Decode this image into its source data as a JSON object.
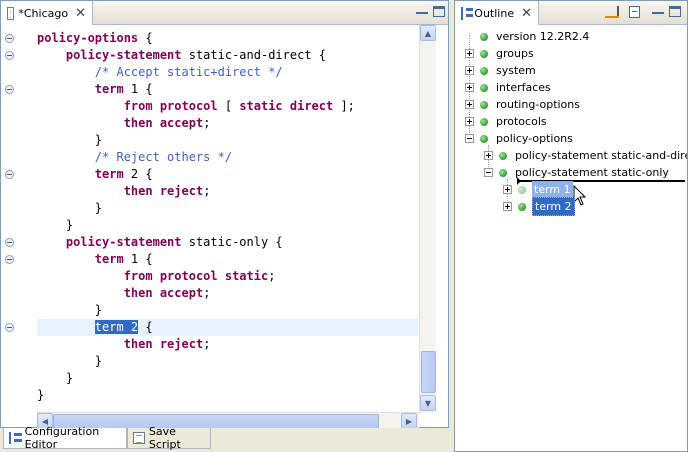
{
  "editor": {
    "tab_title": "*Chicago",
    "close_glyph": "✕",
    "lines": [
      {
        "indent": "",
        "parts": [
          {
            "t": "policy-options",
            "k": "kw"
          },
          {
            "t": " {"
          }
        ]
      },
      {
        "indent": "    ",
        "parts": [
          {
            "t": "policy-statement",
            "k": "kw"
          },
          {
            "t": " static-and-direct {"
          }
        ]
      },
      {
        "indent": "        ",
        "parts": [
          {
            "t": "/* Accept static+direct */",
            "k": "cm"
          }
        ]
      },
      {
        "indent": "        ",
        "parts": [
          {
            "t": "term",
            "k": "kw"
          },
          {
            "t": " 1 {"
          }
        ]
      },
      {
        "indent": "            ",
        "parts": [
          {
            "t": "from protocol",
            "k": "kw"
          },
          {
            "t": " [ "
          },
          {
            "t": "static direct",
            "k": "kw"
          },
          {
            "t": " ];"
          }
        ]
      },
      {
        "indent": "            ",
        "parts": [
          {
            "t": "then accept",
            "k": "kw"
          },
          {
            "t": ";"
          }
        ]
      },
      {
        "indent": "        ",
        "parts": [
          {
            "t": "}"
          }
        ]
      },
      {
        "indent": "        ",
        "parts": [
          {
            "t": "/* Reject others */",
            "k": "cm"
          }
        ]
      },
      {
        "indent": "        ",
        "parts": [
          {
            "t": "term",
            "k": "kw"
          },
          {
            "t": " 2 {"
          }
        ]
      },
      {
        "indent": "            ",
        "parts": [
          {
            "t": "then reject",
            "k": "kw"
          },
          {
            "t": ";"
          }
        ]
      },
      {
        "indent": "        ",
        "parts": [
          {
            "t": "}"
          }
        ]
      },
      {
        "indent": "    ",
        "parts": [
          {
            "t": "}"
          }
        ]
      },
      {
        "indent": "    ",
        "parts": [
          {
            "t": "policy-statement",
            "k": "kw"
          },
          {
            "t": " static-only {"
          }
        ]
      },
      {
        "indent": "        ",
        "parts": [
          {
            "t": "term",
            "k": "kw"
          },
          {
            "t": " 1 {"
          }
        ]
      },
      {
        "indent": "            ",
        "parts": [
          {
            "t": "from protocol static",
            "k": "kw"
          },
          {
            "t": ";"
          }
        ]
      },
      {
        "indent": "            ",
        "parts": [
          {
            "t": "then accept",
            "k": "kw"
          },
          {
            "t": ";"
          }
        ]
      },
      {
        "indent": "        ",
        "parts": [
          {
            "t": "}"
          }
        ]
      },
      {
        "indent": "        ",
        "parts": [
          {
            "t": "term 2",
            "k": "sel"
          },
          {
            "t": " {"
          }
        ],
        "current": true
      },
      {
        "indent": "            ",
        "parts": [
          {
            "t": "then reject",
            "k": "kw"
          },
          {
            "t": ";"
          }
        ]
      },
      {
        "indent": "        ",
        "parts": [
          {
            "t": "}"
          }
        ]
      },
      {
        "indent": "    ",
        "parts": [
          {
            "t": "}"
          }
        ]
      },
      {
        "indent": "",
        "parts": [
          {
            "t": "}"
          }
        ]
      }
    ],
    "fold_lines": [
      0,
      1,
      3,
      8,
      12,
      13,
      17
    ]
  },
  "bottom_tabs": [
    {
      "label": "Configuration Editor",
      "icon": "config-editor-icon",
      "active": true
    },
    {
      "label": "Save Script",
      "icon": "save-script-icon",
      "active": false
    }
  ],
  "outline": {
    "tab_title": "Outline",
    "close_glyph": "✕",
    "nodes": [
      {
        "label": "version 12.2R2.4",
        "expander": "none",
        "depth": 0
      },
      {
        "label": "groups",
        "expander": "plus",
        "depth": 0
      },
      {
        "label": "system",
        "expander": "plus",
        "depth": 0
      },
      {
        "label": "interfaces",
        "expander": "plus",
        "depth": 0
      },
      {
        "label": "routing-options",
        "expander": "plus",
        "depth": 0
      },
      {
        "label": "protocols",
        "expander": "plus",
        "depth": 0
      },
      {
        "label": "policy-options",
        "expander": "minus",
        "depth": 0
      },
      {
        "label": "policy-statement static-and-direct",
        "expander": "plus",
        "depth": 1
      },
      {
        "label": "policy-statement static-only",
        "expander": "minus",
        "depth": 1
      },
      {
        "label": "term 1",
        "expander": "plus",
        "depth": 2,
        "state": "drag-target"
      },
      {
        "label": "term 2",
        "expander": "plus",
        "depth": 2,
        "state": "selected"
      }
    ]
  },
  "colors": {
    "keyword": "#7f0055",
    "comment": "#3f5fbf",
    "selection": "#316ac5",
    "current_line": "#e8f2fe",
    "node_icon": "#2f9b2f"
  }
}
